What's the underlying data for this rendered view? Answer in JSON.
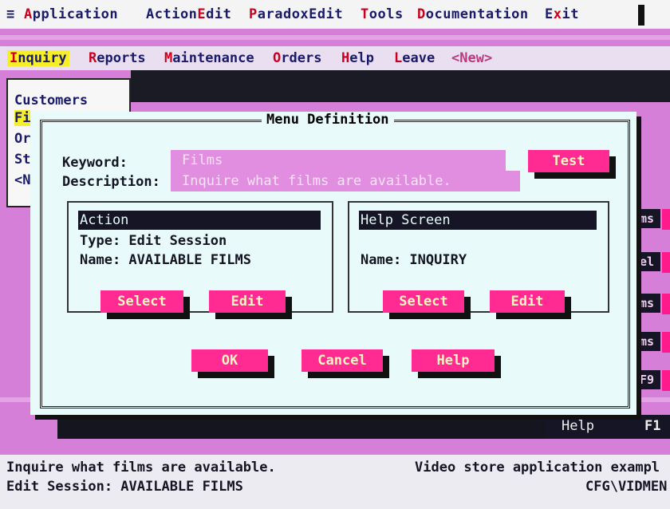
{
  "topbar": {
    "system_icon": "≡",
    "items": [
      {
        "hot": "A",
        "rest": "pplication"
      },
      {
        "pre": "Action",
        "hot": "E",
        "rest": "dit"
      },
      {
        "hot": "P",
        "rest": "aradoxEdit"
      },
      {
        "hot": "T",
        "rest": "ools"
      },
      {
        "hot": "D",
        "rest": "ocumentation"
      },
      {
        "pre": "E",
        "hot": "x",
        "rest": "it"
      }
    ]
  },
  "menubar": {
    "items": [
      {
        "hot": "I",
        "rest": "nquiry"
      },
      {
        "hot": "R",
        "rest": "eports"
      },
      {
        "hot": "M",
        "rest": "aintenance"
      },
      {
        "hot": "O",
        "rest": "rders"
      },
      {
        "hot": "H",
        "rest": "elp"
      },
      {
        "hot": "L",
        "rest": "eave"
      },
      {
        "label": "<New>"
      }
    ]
  },
  "dropdown": {
    "items": [
      "Customers",
      "Fi",
      "Or",
      "St",
      "<N"
    ]
  },
  "right_strips": [
    "ms",
    "el",
    "ms",
    "ms",
    "F9"
  ],
  "help_strip": {
    "label": "Help",
    "key": "F1"
  },
  "dialog": {
    "title": "Menu Definition",
    "keyword_label": "Keyword:",
    "keyword_value": "Films",
    "description_label": "Description:",
    "description_value": "Inquire what films are available.",
    "test_button": "Test",
    "action": {
      "title": "Action",
      "type_line": "Type: Edit Session",
      "name_line": "Name: AVAILABLE FILMS",
      "select_button": "Select",
      "edit_button": "Edit"
    },
    "help_screen": {
      "title": "Help Screen",
      "name_line": "Name: INQUIRY",
      "select_button": "Select",
      "edit_button": "Edit"
    },
    "ok_button": "OK",
    "cancel_button": "Cancel",
    "help_button": "Help"
  },
  "status": {
    "line1_left": "Inquire what films are available.",
    "line1_right": "Video store application exampl",
    "line2_left": "Edit Session: AVAILABLE FILMS",
    "line2_right": "CFG\\VIDMEN"
  },
  "colors": {
    "desktop": "#d67fd8",
    "button": "#ff2a92",
    "field": "#e28ee0",
    "dialog": "#e8fbfa",
    "hotkey": "#c8001e",
    "selection": "#f6ee27"
  }
}
